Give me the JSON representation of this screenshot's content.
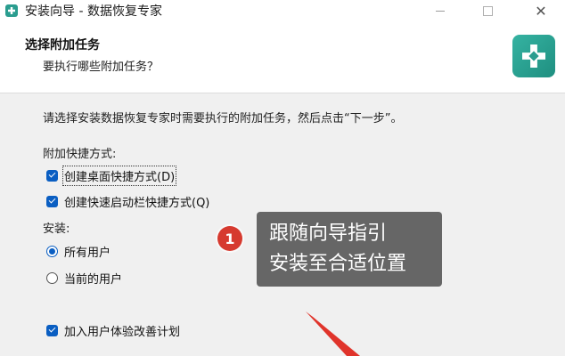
{
  "window": {
    "title": "安装向导 - 数据恢复专家",
    "controls": {
      "minimize": "",
      "maximize": "",
      "close": "✕"
    }
  },
  "header": {
    "title": "选择附加任务",
    "subtitle": "要执行哪些附加任务？"
  },
  "body": {
    "intro": "请选择安装数据恢复专家时需要执行的附加任务，然后点击“下一步”。",
    "shortcuts_label": "附加快捷方式:",
    "shortcut_options": [
      {
        "label": "创建桌面快捷方式(D)",
        "checked": true
      },
      {
        "label": "创建快速启动栏快捷方式(Q)",
        "checked": true
      }
    ],
    "install_label": "安装:",
    "install_options": [
      {
        "label": "所有用户",
        "selected": true
      },
      {
        "label": "当前的用户",
        "selected": false
      }
    ],
    "experience_option": {
      "label": "加入用户体验改善计划",
      "checked": true
    }
  },
  "annotation": {
    "step_number": "1",
    "callout_line1": "跟随向导指引",
    "callout_line2": "安装至合适位置",
    "badge_color": "#d63a2f",
    "arrow_color": "#e0342b"
  },
  "colors": {
    "accent": "#0a5ec2",
    "brand": "#2a9d8f"
  }
}
